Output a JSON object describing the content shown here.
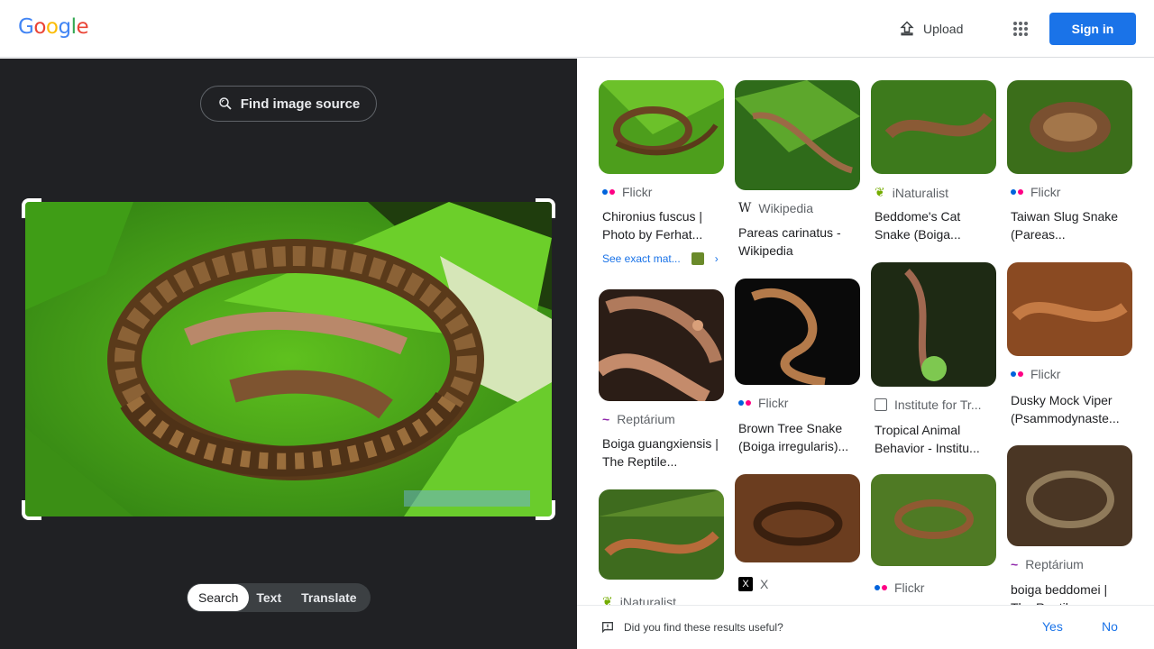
{
  "header": {
    "logo_letters": [
      {
        "ch": "G",
        "color": "#4285f4"
      },
      {
        "ch": "o",
        "color": "#ea4335"
      },
      {
        "ch": "o",
        "color": "#fbbc05"
      },
      {
        "ch": "g",
        "color": "#4285f4"
      },
      {
        "ch": "l",
        "color": "#34a853"
      },
      {
        "ch": "e",
        "color": "#ea4335"
      }
    ],
    "upload_label": "Upload",
    "signin_label": "Sign in"
  },
  "left": {
    "find_source_label": "Find image source",
    "modes": [
      {
        "label": "Search",
        "active": true
      },
      {
        "label": "Text",
        "active": false
      },
      {
        "label": "Translate",
        "active": false
      }
    ]
  },
  "results": [
    {
      "source": "Flickr",
      "source_icon": "flickr-icon",
      "title": "Chironius fuscus | Photo by Ferhat...",
      "exact_match": "See exact mat..."
    },
    {
      "source": "Reptárium",
      "source_icon": "reptarium-icon",
      "title": "Boiga guangxiensis | The Reptile..."
    },
    {
      "source": "iNaturalist",
      "source_icon": "inaturalist-icon",
      "title": ""
    },
    {
      "source": "Wikipedia",
      "source_icon": "wikipedia-icon",
      "title": "Pareas carinatus - Wikipedia"
    },
    {
      "source": "Flickr",
      "source_icon": "flickr-icon",
      "title": "Brown Tree Snake (Boiga irregularis)..."
    },
    {
      "source": "X",
      "source_icon": "x-icon",
      "title": ""
    },
    {
      "source": "iNaturalist",
      "source_icon": "inaturalist-icon",
      "title": "Beddome's Cat Snake (Boiga..."
    },
    {
      "source": "Institute for Tr...",
      "source_icon": "institute-icon",
      "title": "Tropical Animal Behavior - Institu..."
    },
    {
      "source": "Flickr",
      "source_icon": "flickr-icon",
      "title": ""
    },
    {
      "source": "Flickr",
      "source_icon": "flickr-icon",
      "title": "Taiwan Slug Snake (Pareas..."
    },
    {
      "source": "Flickr",
      "source_icon": "flickr-icon",
      "title": "Dusky Mock Viper (Psammodynaste..."
    },
    {
      "source": "Reptárium",
      "source_icon": "reptarium-icon",
      "title": "boiga beddomei | The Reptil..."
    }
  ],
  "feedback": {
    "question": "Did you find these results useful?",
    "yes_label": "Yes",
    "no_label": "No"
  },
  "colors": {
    "accent": "#1a73e8",
    "dark_panel": "#202124",
    "flickr_blue": "#0063dc",
    "flickr_pink": "#ff0084"
  }
}
